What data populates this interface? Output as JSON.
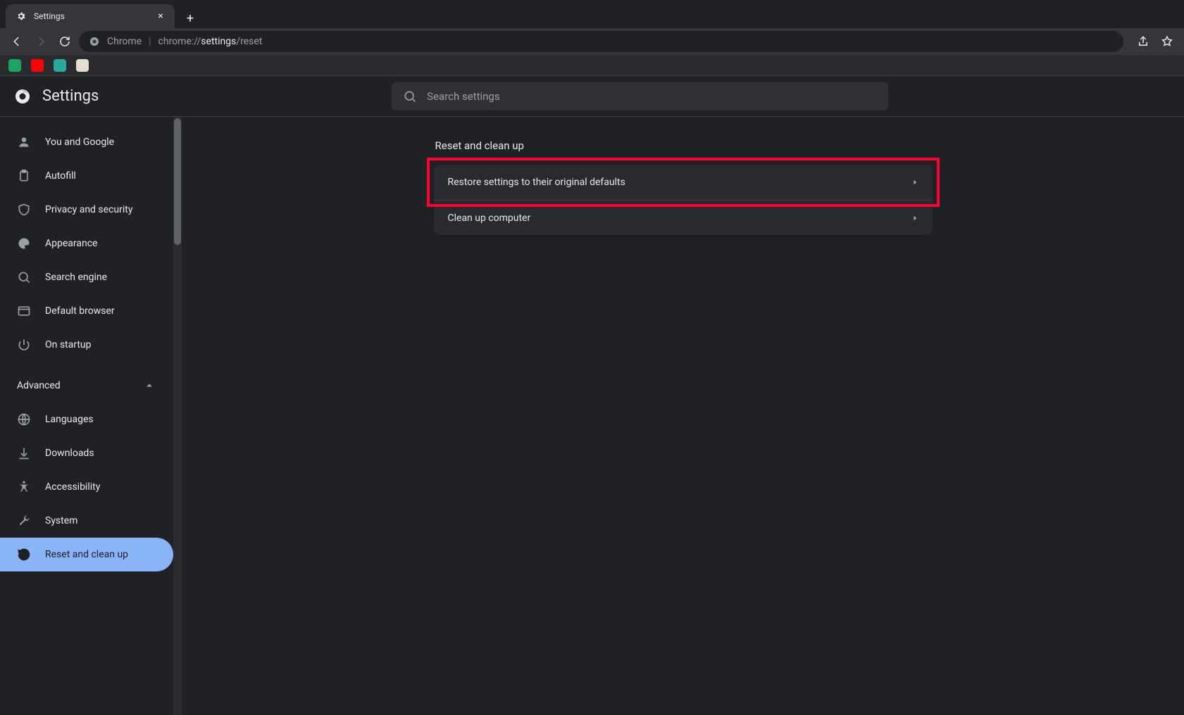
{
  "window": {
    "tab_title": "Settings",
    "new_tab_glyph": "+",
    "close_glyph": "×"
  },
  "omnibox": {
    "scheme_label": "Chrome",
    "separator": "|",
    "url_prefix": "chrome://",
    "url_mid": "settings",
    "url_suffix": "/reset"
  },
  "settings": {
    "title": "Settings",
    "search_placeholder": "Search settings"
  },
  "sidebar": {
    "items": [
      {
        "label": "You and Google"
      },
      {
        "label": "Autofill"
      },
      {
        "label": "Privacy and security"
      },
      {
        "label": "Appearance"
      },
      {
        "label": "Search engine"
      },
      {
        "label": "Default browser"
      },
      {
        "label": "On startup"
      }
    ],
    "advanced_label": "Advanced",
    "advanced_items": [
      {
        "label": "Languages"
      },
      {
        "label": "Downloads"
      },
      {
        "label": "Accessibility"
      },
      {
        "label": "System"
      },
      {
        "label": "Reset and clean up"
      }
    ]
  },
  "main": {
    "section_title": "Reset and clean up",
    "rows": [
      {
        "label": "Restore settings to their original defaults"
      },
      {
        "label": "Clean up computer"
      }
    ]
  },
  "highlight": {
    "row_index": 0
  }
}
